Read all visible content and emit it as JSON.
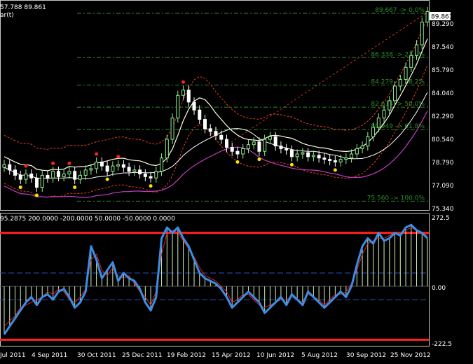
{
  "header": {
    "main_price_text": "57.788 89.861",
    "main_sub_text": "ar(t)",
    "indicator_params": "95.2875 200.0000 -200.0000 50.0000 -50.0000 0.0000"
  },
  "price_axis": {
    "current_price": "89.861",
    "labels": [
      "89.290",
      "87.540",
      "85.790",
      "84.040",
      "82.290",
      "80.540",
      "78.790",
      "77.090",
      "75.340"
    ]
  },
  "indicator_axis": {
    "labels": [
      "272.5",
      "0.00",
      "-222.5"
    ]
  },
  "fibonacci": {
    "levels": [
      {
        "value": 89.667,
        "text": "89.667 -> 0.0%"
      },
      {
        "value": 86.338,
        "text": "86.338 -> 23.6%"
      },
      {
        "value": 84.279,
        "text": "84.279 -> 38.2%"
      },
      {
        "value": 82.614,
        "text": "82.614 -> 50.0%"
      },
      {
        "value": 80.949,
        "text": "80.949 -> 61.8%"
      },
      {
        "value": 75.56,
        "text": "75.560 -> 100.0%"
      }
    ]
  },
  "time_axis": {
    "labels": [
      "Jul 2011",
      "4 Sep 2011",
      "30 Oct 2011",
      "25 Dec 2011",
      "19 Feb 2012",
      "15 Apr 2012",
      "10 Jun 2012",
      "5 Aug 2012",
      "30 Sep 2012",
      "25 Nov 2012"
    ]
  },
  "colors": {
    "background": "#000000",
    "bull_candle": "#90ee90",
    "bear_candle": "#ffffff",
    "ma_white": "#ffffe0",
    "ma_magenta": "#c040c0",
    "envelope": "#e04020",
    "fib_line": "#2e8b2e",
    "cci_main": "#3a8ee6",
    "cci_signal": "#e02020",
    "histogram": "#d0f0b0",
    "threshold_line": "#ff2020",
    "dash_line": "#3050c0"
  },
  "chart_data": [
    {
      "type": "candlestick",
      "title": "",
      "ylim": [
        75.0,
        90.4
      ],
      "x_ticks": [
        "Jul 2011",
        "4 Sep 2011",
        "30 Oct 2011",
        "25 Dec 2011",
        "19 Feb 2012",
        "15 Apr 2012",
        "10 Jun 2012",
        "5 Aug 2012",
        "30 Sep 2012",
        "25 Nov 2012"
      ],
      "series": [
        {
          "name": "close",
          "values": [
            78.3,
            77.9,
            77.5,
            77.2,
            77.6,
            77.3,
            76.6,
            77.5,
            77.3,
            77.8,
            77.4,
            77.6,
            77.8,
            77.2,
            77.5,
            77.9,
            78.0,
            78.5,
            78.2,
            77.8,
            78.2,
            78.3,
            78.1,
            77.8,
            77.9,
            77.6,
            77.4,
            77.3,
            77.8,
            78.8,
            80.2,
            81.8,
            83.5,
            83.9,
            83.0,
            82.4,
            81.7,
            81.0,
            80.8,
            80.5,
            80.2,
            79.6,
            79.3,
            79.1,
            79.5,
            79.8,
            80.0,
            79.3,
            80.2,
            80.4,
            79.7,
            79.5,
            79.4,
            78.9,
            79.1,
            79.2,
            78.9,
            79.0,
            78.8,
            78.7,
            78.6,
            78.5,
            78.7,
            78.8,
            79.1,
            79.5,
            79.7,
            80.4,
            81.1,
            81.8,
            82.4,
            83.1,
            84.2,
            84.7,
            85.6,
            86.5,
            87.3,
            89.0,
            89.8
          ]
        }
      ]
    },
    {
      "type": "line",
      "title": "",
      "ylim": [
        -222.5,
        272.5
      ],
      "series": [
        {
          "name": "",
          "values": [
            -180,
            -150,
            -120,
            -90,
            -60,
            -40,
            -70,
            -40,
            -30,
            -50,
            -20,
            -10,
            -40,
            -80,
            -60,
            -20,
            150,
            100,
            30,
            60,
            90,
            20,
            50,
            30,
            20,
            -10,
            -60,
            -90,
            -40,
            180,
            220,
            200,
            220,
            180,
            150,
            100,
            50,
            30,
            20,
            10,
            -10,
            -40,
            -80,
            -60,
            -40,
            -20,
            -40,
            -60,
            -100,
            -80,
            -60,
            -40,
            -70,
            -30,
            -50,
            -70,
            -20,
            -40,
            -60,
            -80,
            -60,
            -40,
            -20,
            -40,
            0,
            80,
            150,
            180,
            160,
            200,
            170,
            180,
            200,
            190,
            220,
            230,
            210,
            200,
            180
          ]
        },
        {
          "name": "",
          "values": [
            -150,
            -130,
            -110,
            -80,
            -70,
            -60,
            -50,
            -40,
            -20,
            -30,
            -10,
            -20,
            -50,
            -60,
            -40,
            -10,
            100,
            120,
            60,
            40,
            70,
            40,
            30,
            40,
            10,
            -20,
            -40,
            -70,
            -20,
            120,
            200,
            210,
            200,
            170,
            140,
            110,
            70,
            40,
            30,
            20,
            0,
            -20,
            -60,
            -50,
            -30,
            -30,
            -50,
            -70,
            -80,
            -70,
            -60,
            -50,
            -50,
            -40,
            -50,
            -60,
            -30,
            -40,
            -50,
            -70,
            -50,
            -30,
            -30,
            -20,
            10,
            60,
            120,
            160,
            170,
            180,
            180,
            190,
            200,
            200,
            210,
            220,
            210,
            200,
            190
          ]
        }
      ]
    }
  ]
}
